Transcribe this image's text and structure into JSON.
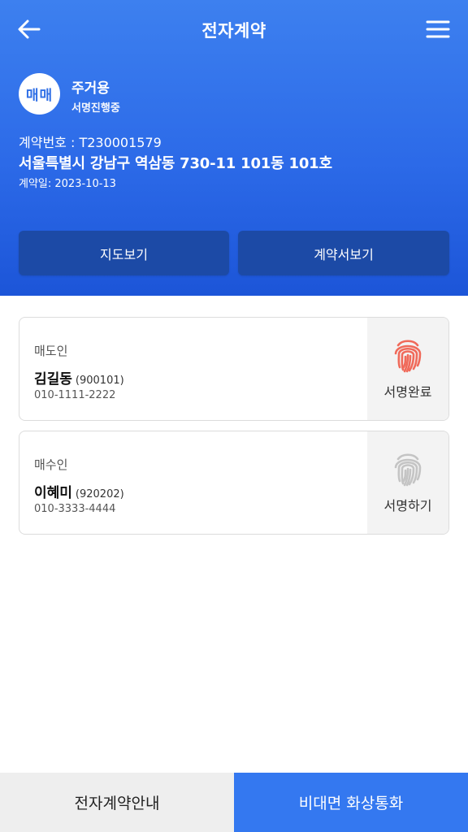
{
  "header": {
    "title": "전자계약",
    "back_icon": "arrow-left-icon",
    "menu_icon": "hamburger-menu-icon"
  },
  "property": {
    "badge": "매매",
    "type": "주거용",
    "status": "서명진행중",
    "contract_number": "계약번호 : T230001579",
    "address": "서울특별시 강남구 역삼동 730-11 101동 101호",
    "contract_date": "계약일: 2023-10-13"
  },
  "actions": {
    "map_label": "지도보기",
    "document_label": "계약서보기"
  },
  "parties": [
    {
      "role": "매도인",
      "name": "김길동",
      "birth": "(900101)",
      "phone": "010-1111-2222",
      "sign_label": "서명완료",
      "sign_icon": "fingerprint-icon",
      "sign_color": "#f06a5a"
    },
    {
      "role": "매수인",
      "name": "이혜미",
      "birth": "(920202)",
      "phone": "010-3333-4444",
      "sign_label": "서명하기",
      "sign_icon": "fingerprint-icon",
      "sign_color": "#c4c4c4"
    }
  ],
  "footer": {
    "guide_label": "전자계약안내",
    "video_call_label": "비대면 화상통화"
  },
  "colors": {
    "header_top": "#3d80ef",
    "header_bottom": "#1c55d8",
    "header_button": "#1c4aa6",
    "accent": "#3478f0"
  }
}
